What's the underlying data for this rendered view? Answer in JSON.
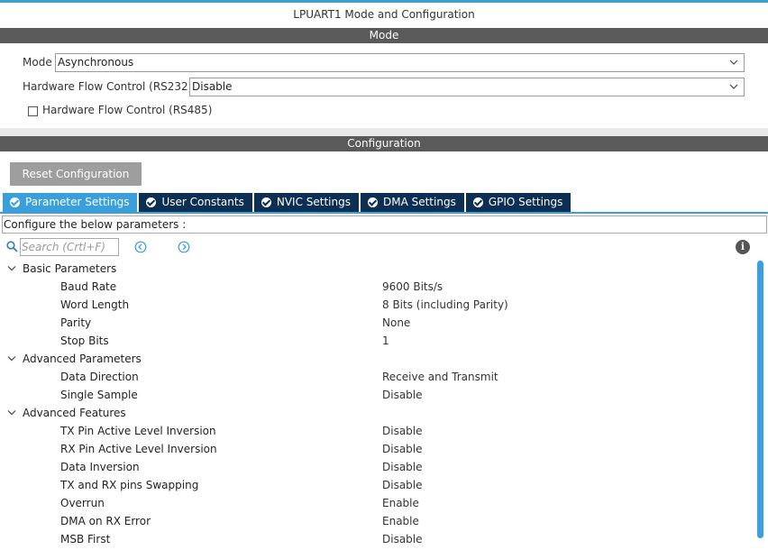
{
  "panel_title": "LPUART1 Mode and Configuration",
  "mode_section": {
    "title": "Mode",
    "mode_label": "Mode",
    "mode_value": "Asynchronous",
    "hw_flow_rs232_label": "Hardware Flow Control (RS232)",
    "hw_flow_rs232_value": "Disable",
    "hw_flow_rs485_label": "Hardware Flow Control (RS485)",
    "hw_flow_rs485_checked": false
  },
  "config_section": {
    "title": "Configuration",
    "reset_label": "Reset Configuration",
    "tabs": [
      {
        "label": "Parameter Settings",
        "active": true
      },
      {
        "label": "User Constants",
        "active": false
      },
      {
        "label": "NVIC Settings",
        "active": false
      },
      {
        "label": "DMA Settings",
        "active": false
      },
      {
        "label": "GPIO Settings",
        "active": false
      }
    ],
    "configure_text": "Configure the below parameters :",
    "search_placeholder": "Search (Crtl+F)"
  },
  "parameters": {
    "basic": {
      "title": "Basic Parameters",
      "items": [
        {
          "name": "Baud Rate",
          "value": "9600 Bits/s"
        },
        {
          "name": "Word Length",
          "value": "8 Bits (including Parity)"
        },
        {
          "name": "Parity",
          "value": "None"
        },
        {
          "name": "Stop Bits",
          "value": "1"
        }
      ]
    },
    "advanced": {
      "title": "Advanced Parameters",
      "items": [
        {
          "name": "Data Direction",
          "value": "Receive and Transmit"
        },
        {
          "name": "Single Sample",
          "value": "Disable"
        }
      ]
    },
    "features": {
      "title": "Advanced Features",
      "items": [
        {
          "name": "TX Pin Active Level Inversion",
          "value": "Disable"
        },
        {
          "name": "RX Pin Active Level Inversion",
          "value": "Disable"
        },
        {
          "name": "Data Inversion",
          "value": "Disable"
        },
        {
          "name": "TX and RX pins Swapping",
          "value": "Disable"
        },
        {
          "name": "Overrun",
          "value": "Enable"
        },
        {
          "name": "DMA on RX Error",
          "value": "Enable"
        },
        {
          "name": "MSB First",
          "value": "Disable"
        }
      ]
    }
  },
  "colors": {
    "accent": "#3aa0dc",
    "tab_inactive": "#0e2f54",
    "section_bar": "#5a5a5a"
  },
  "icons": {
    "search": "search-icon",
    "prev": "arrow-left-circle-icon",
    "next": "arrow-right-circle-icon",
    "info": "info-icon",
    "check": "check-circle-icon",
    "chevron": "chevron-down-icon"
  }
}
